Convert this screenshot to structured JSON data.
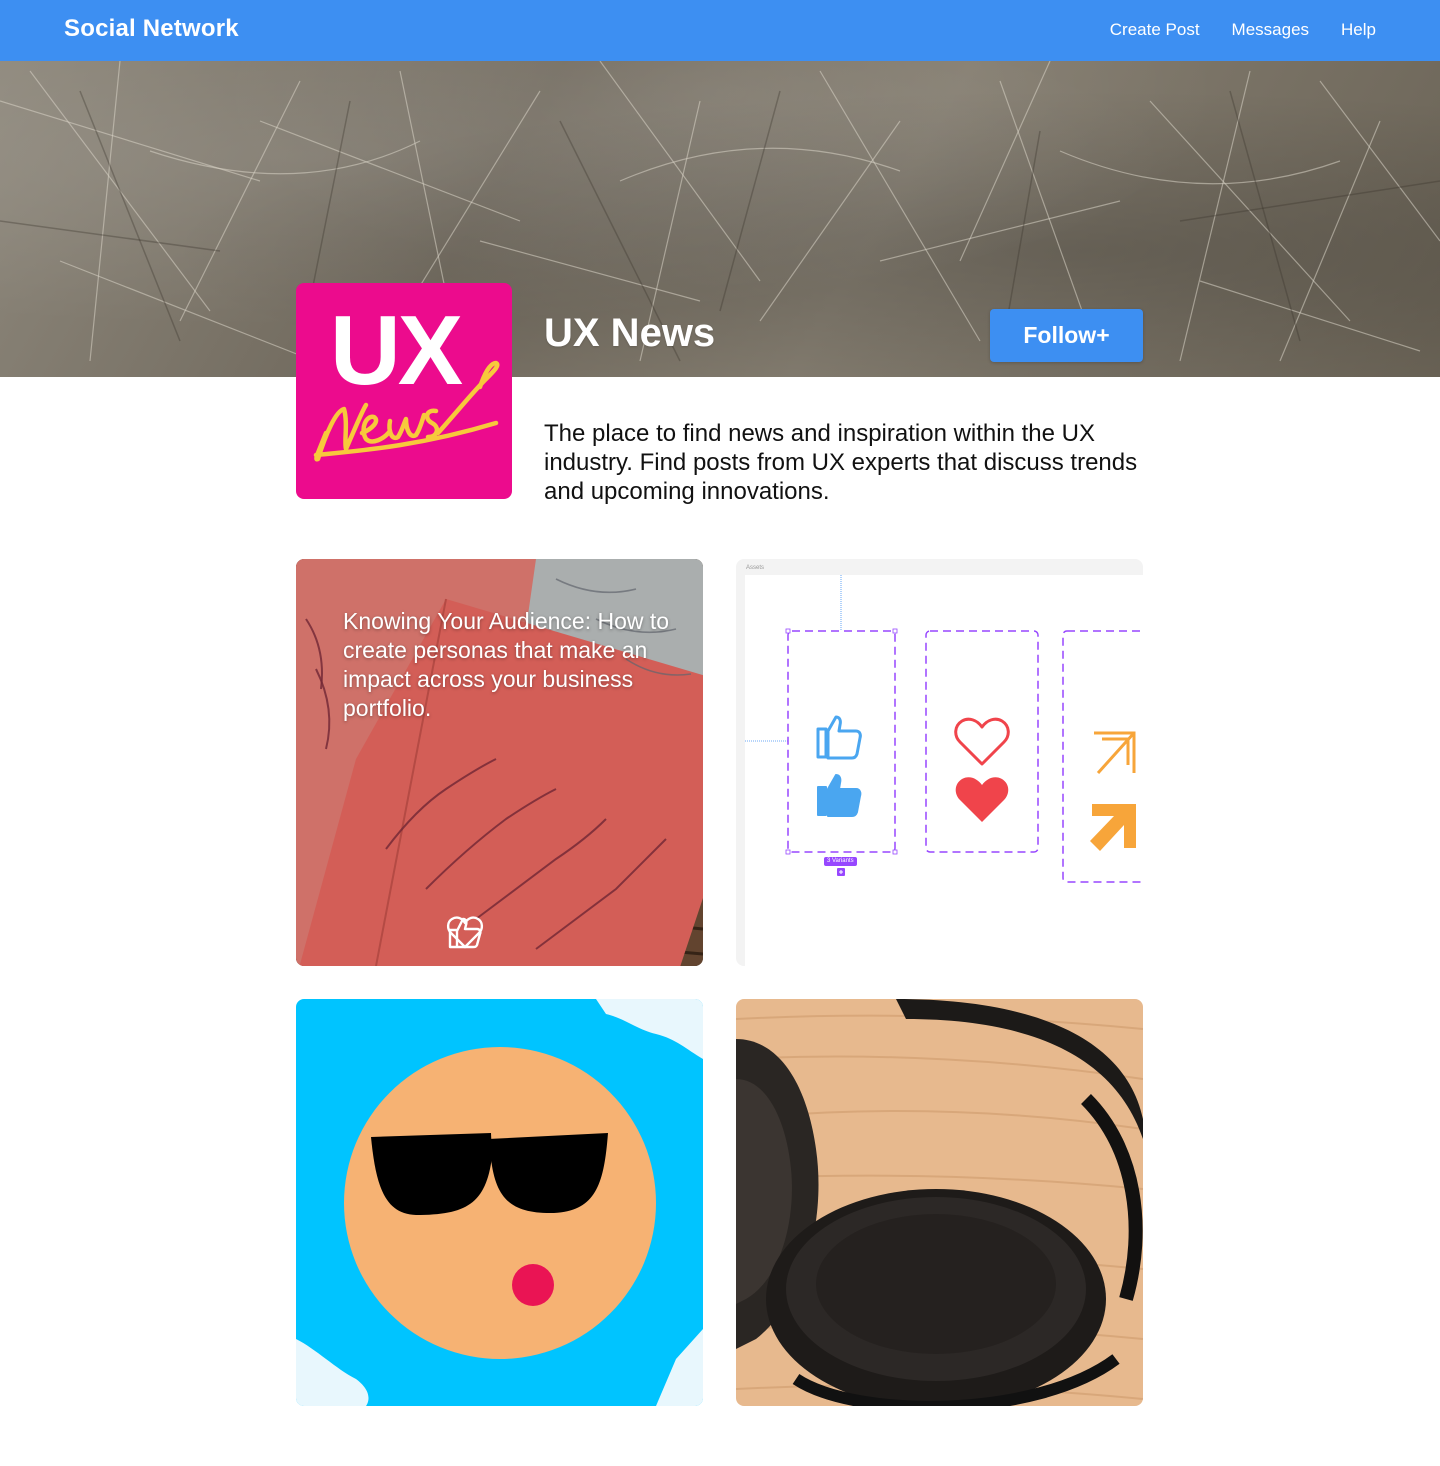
{
  "header": {
    "brand": "Social Network",
    "nav": [
      {
        "label": "Create Post"
      },
      {
        "label": "Messages"
      },
      {
        "label": "Help"
      }
    ]
  },
  "profile": {
    "avatar_text": "UX",
    "avatar_script": "News",
    "name": "UX News",
    "follow_label": "Follow+",
    "description": "The place to find news and inspiration within the UX industry. Find posts from UX experts that discuss trends and upcoming innovations."
  },
  "posts": [
    {
      "overlay_text": "Knowing Your Audience: How to create personas that make an impact across your business portfolio.",
      "actions": [
        {
          "icon": "thumbs-up-icon"
        },
        {
          "icon": "heart-icon"
        }
      ]
    },
    {
      "panel_label": "Assets",
      "variant_tag": "3 Variants",
      "icons": [
        "thumbs-up-icon",
        "heart-icon",
        "arrow-up-right-icon"
      ]
    },
    {
      "image": "sunglasses-face"
    },
    {
      "image": "headphones"
    }
  ],
  "colors": {
    "primary": "#3d8ff2",
    "avatar_bg": "#ec0b8d",
    "avatar_script": "#f7c93c",
    "figma_purple": "#9747ff",
    "icon_blue": "#4aa6f0",
    "icon_red": "#f0444b",
    "icon_orange": "#f7a53a",
    "sky_blue": "#00c4ff",
    "face": "#f6b273"
  }
}
